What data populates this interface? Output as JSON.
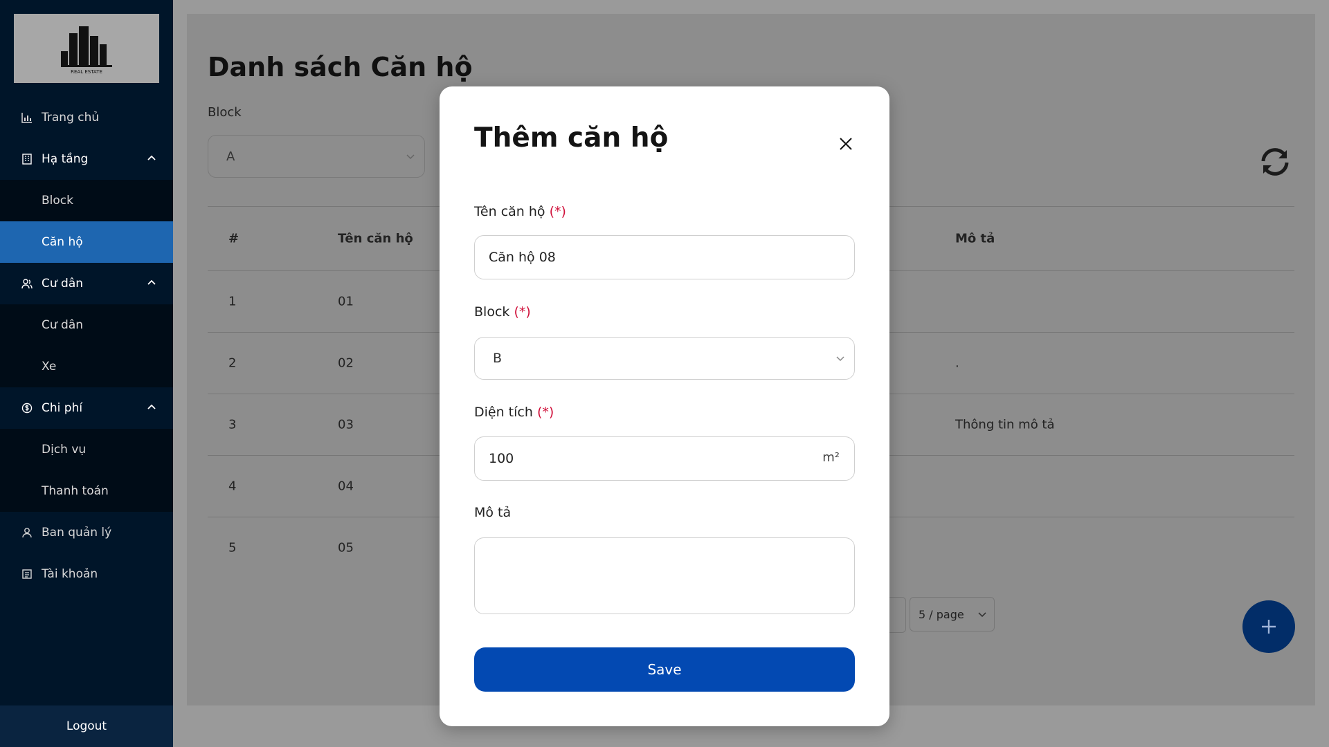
{
  "sidebar": {
    "logo_text": "REAL ESTATE",
    "items": [
      {
        "label": "Trang chủ",
        "icon": "chart-icon"
      },
      {
        "label": "Hạ tầng",
        "icon": "building-icon"
      },
      {
        "label": "Block"
      },
      {
        "label": "Căn hộ",
        "active": true
      },
      {
        "label": "Cư dân",
        "icon": "users-icon"
      },
      {
        "label": "Cư dân"
      },
      {
        "label": "Xe"
      },
      {
        "label": "Chi phí",
        "icon": "money-icon"
      },
      {
        "label": "Dịch vụ"
      },
      {
        "label": "Thanh toán"
      },
      {
        "label": "Ban quản lý",
        "icon": "user-icon"
      },
      {
        "label": "Tài khoản",
        "icon": "account-icon"
      }
    ],
    "logout": "Logout"
  },
  "page": {
    "title": "Danh sách Căn hộ",
    "filter_label": "Block",
    "filter_value": "A",
    "table": {
      "headers": [
        "#",
        "Tên căn hộ",
        "Mô tả"
      ],
      "rows": [
        {
          "idx": "1",
          "name": "01",
          "desc": ""
        },
        {
          "idx": "2",
          "name": "02",
          "desc": "."
        },
        {
          "idx": "3",
          "name": "03",
          "desc": "Thông tin mô tả"
        },
        {
          "idx": "4",
          "name": "04",
          "desc": ""
        },
        {
          "idx": "5",
          "name": "05",
          "desc": ""
        }
      ]
    },
    "page_size": "5 / page"
  },
  "modal": {
    "title": "Thêm căn hộ",
    "required_marker": "(*)",
    "name_label": "Tên căn hộ",
    "name_value": "Căn hộ 08",
    "block_label": "Block",
    "block_value": "B",
    "area_label": "Diện tích",
    "area_value": "100",
    "area_unit": "m²",
    "desc_label": "Mô tả",
    "desc_value": "",
    "save_label": "Save"
  },
  "colors": {
    "sidebar_bg": "#001529",
    "active_item": "#1e66b0",
    "save_button": "#0349b2",
    "required": "#d0103a",
    "fab": "#022d68"
  }
}
